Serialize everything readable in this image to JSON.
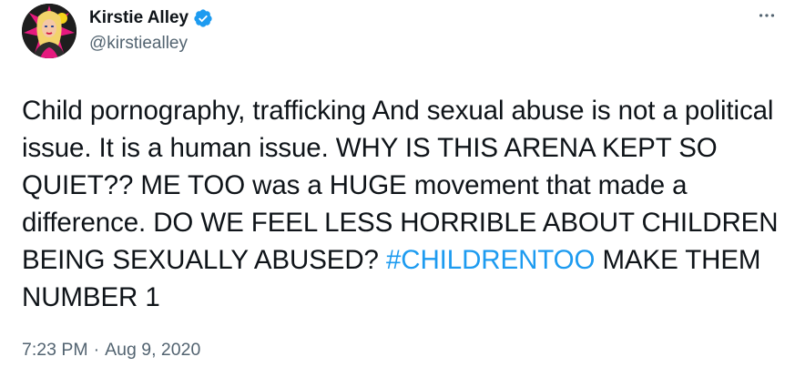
{
  "tweet": {
    "author": {
      "display_name": "Kirstie Alley",
      "handle": "@kirstiealley",
      "verified_icon": "verified-badge-icon",
      "avatar_icon": "profile-avatar"
    },
    "more_icon": "more-options-icon",
    "text_part1": "Child pornography, trafficking And  sexual abuse is not a political issue. It is a human issue. WHY IS THIS ARENA KEPT SO QUIET?? ME TOO was a HUGE movement that made a difference. DO WE FEEL LESS HORRIBLE ABOUT CHILDREN BEING SEXUALLY ABUSED? ",
    "hashtag": "#CHILDRENTOO",
    "text_part2": " MAKE THEM NUMBER 1",
    "time": "7:23 PM",
    "separator": "·",
    "date": "Aug 9, 2020"
  },
  "colors": {
    "link": "#1d9bf0",
    "text": "#0f1419",
    "secondary": "#536471"
  }
}
